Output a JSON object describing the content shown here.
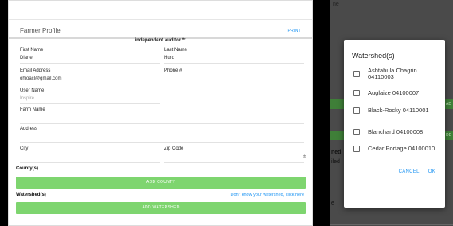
{
  "form": {
    "title": "Farmer Profile",
    "print_label": "PRINT",
    "note": "independent auditor **",
    "fields": {
      "first_name_label": "First Name",
      "first_name_value": "Diane",
      "last_name_label": "Last Name",
      "last_name_value": "Hurd",
      "email_label": "Email Address",
      "email_value": "ohioacl@gmail.com",
      "phone_label": "Phone #",
      "phone_value": "",
      "username_label": "User Name",
      "username_value": "Inspire",
      "farm_name_label": "Farm Name",
      "farm_name_value": "",
      "address_label": "Address",
      "address_value": "",
      "city_label": "City",
      "city_value": "",
      "zip_label": "Zip Code",
      "zip_value": ""
    },
    "select_arrow": "⇕",
    "county_label": "County(s)",
    "add_county_label": "ADD COUNTY",
    "watershed_label": "Watershed(s)",
    "watershed_help": "Don't know your watershed, click here",
    "add_watershed_label": "ADD WATERSHED"
  },
  "background": {
    "fragment_top": "ne",
    "fragment_mid1": "ned",
    "fragment_mid2": "iled",
    "fragment_bottom": "e",
    "btn_fragment1": "AD",
    "btn_fragment2": "DD"
  },
  "dialog": {
    "title": "Watershed(s)",
    "items": [
      "Ashtabula Chagrin 04110003",
      "Auglaize 04100007",
      "Black-Rocky 04110001",
      "Blanchard 04100008",
      "Cedar Portage 04100010"
    ],
    "cancel_label": "CANCEL",
    "ok_label": "OK"
  },
  "colors": {
    "accent_green": "#7ed56f",
    "link_blue": "#2196f3"
  }
}
